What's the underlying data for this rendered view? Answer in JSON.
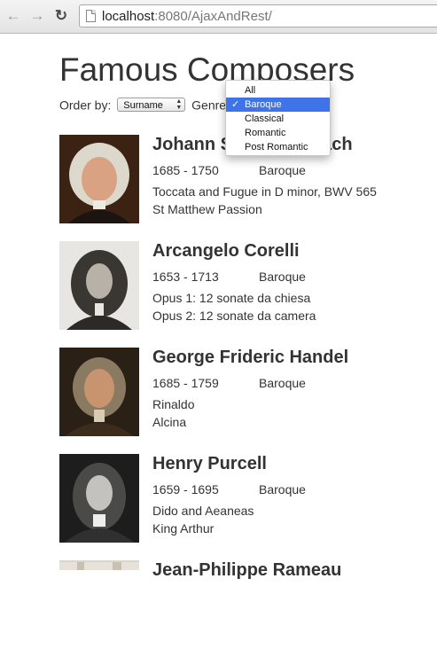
{
  "browser": {
    "url_host": "localhost",
    "url_rest": ":8080/AjaxAndRest/"
  },
  "page": {
    "title": "Famous Composers",
    "order_label": "Order by:",
    "order_value": "Surname",
    "genre_label": "Genres"
  },
  "genre_dropdown": {
    "options": [
      "All",
      "Baroque",
      "Classical",
      "Romantic",
      "Post Romantic"
    ],
    "selected": "Baroque"
  },
  "composers": [
    {
      "name": "Johann Sebastian Bach",
      "years": "1685 - 1750",
      "genre": "Baroque",
      "works": [
        "Toccata and Fugue in D minor, BWV 565",
        "St Matthew Passion"
      ]
    },
    {
      "name": "Arcangelo Corelli",
      "years": "1653 - 1713",
      "genre": "Baroque",
      "works": [
        "Opus 1: 12 sonate da chiesa",
        "Opus 2: 12 sonate da camera"
      ]
    },
    {
      "name": "George Frideric Handel",
      "years": "1685 - 1759",
      "genre": "Baroque",
      "works": [
        "Rinaldo",
        "Alcina"
      ]
    },
    {
      "name": "Henry Purcell",
      "years": "1659 - 1695",
      "genre": "Baroque",
      "works": [
        "Dido and Aeaneas",
        "King Arthur"
      ]
    },
    {
      "name": "Jean-Philippe Rameau",
      "years": "",
      "genre": "",
      "works": []
    }
  ]
}
